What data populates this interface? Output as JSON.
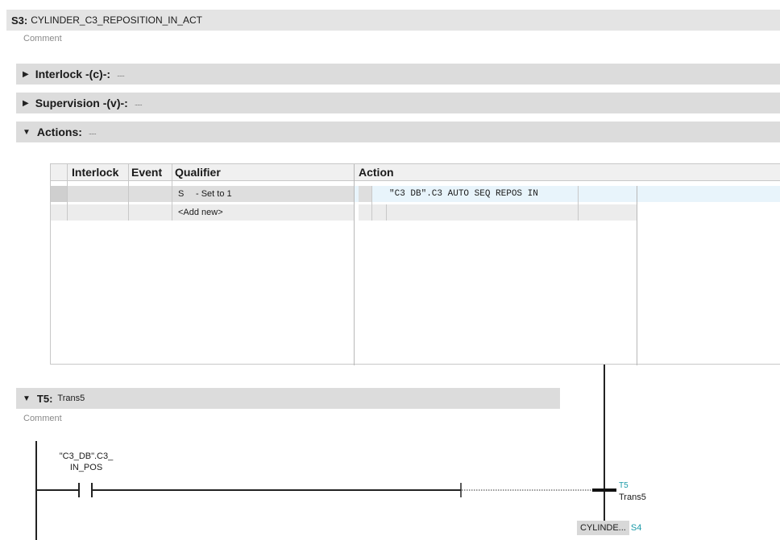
{
  "step": {
    "number": "S3:",
    "name": "CYLINDER_C3_REPOSITION_IN_ACT",
    "comment": "Comment"
  },
  "sections": {
    "interlock": {
      "label": "Interlock -(c)-:",
      "dots": "......"
    },
    "supervision": {
      "label": "Supervision -(v)-:",
      "dots": "......"
    },
    "actions": {
      "label": "Actions:",
      "dots": "......"
    }
  },
  "table": {
    "headers": {
      "interlock": "Interlock",
      "event": "Event",
      "qualifier": "Qualifier",
      "action": "Action"
    },
    "rows": [
      {
        "qualifier_code": "S",
        "qualifier_desc": "- Set to 1",
        "action": "\"C3 DB\".C3 AUTO SEQ REPOS IN"
      }
    ],
    "add_new": "<Add new>"
  },
  "transition": {
    "number": "T5:",
    "name": "Trans5",
    "comment": "Comment",
    "contact_line1": "\"C3_DB\".C3_",
    "contact_line2": "IN_POS",
    "tag": "T5",
    "tag_name": "Trans5",
    "next_step_label": "CYLINDE...",
    "next_step_number": "S4"
  },
  "colors": {
    "section_bar": "#dcdcdc",
    "accent_teal": "#1a9aa8",
    "selected_row": "#e8f4fb"
  }
}
